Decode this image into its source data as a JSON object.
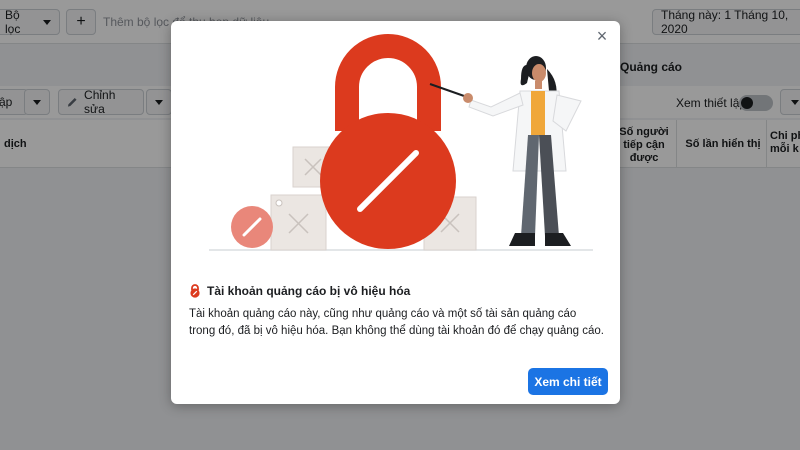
{
  "toolbar": {
    "filter_label": "Bộ lọc",
    "add_label": "+",
    "filter_hint": "Thêm bộ lọc để thu hẹp dữ liệu",
    "date_range": "Tháng này: 1 Tháng 10, 2020"
  },
  "tabs": {
    "ads_label": "Quảng cáo"
  },
  "actions": {
    "first_button_label": "ập",
    "edit_label": "Chỉnh sửa",
    "view_setup_label": "Xem thiết lập"
  },
  "table": {
    "headers": [
      "dịch",
      "Số người tiếp cận được",
      "Số lần hiển thị",
      "Chi phí mỗi k"
    ]
  },
  "modal": {
    "title": "Tài khoản quảng cáo bị vô hiệu hóa",
    "body": "Tài khoản quảng cáo này, cũng như quảng cáo và một số tài sản quảng cáo trong đó, đã bị vô hiệu hóa. Bạn không thể dùng tài khoản đó để chạy quảng cáo.",
    "cta_label": "Xem chi tiết",
    "close_symbol": "×"
  },
  "colors": {
    "accent": "#1b74e4",
    "lock_red": "#dc3a1e",
    "lock_light": "#e9877a",
    "overlay": "#000000"
  },
  "icons": [
    "caret-down-icon",
    "plus-icon",
    "pencil-icon",
    "close-icon",
    "warning-lock-icon"
  ]
}
